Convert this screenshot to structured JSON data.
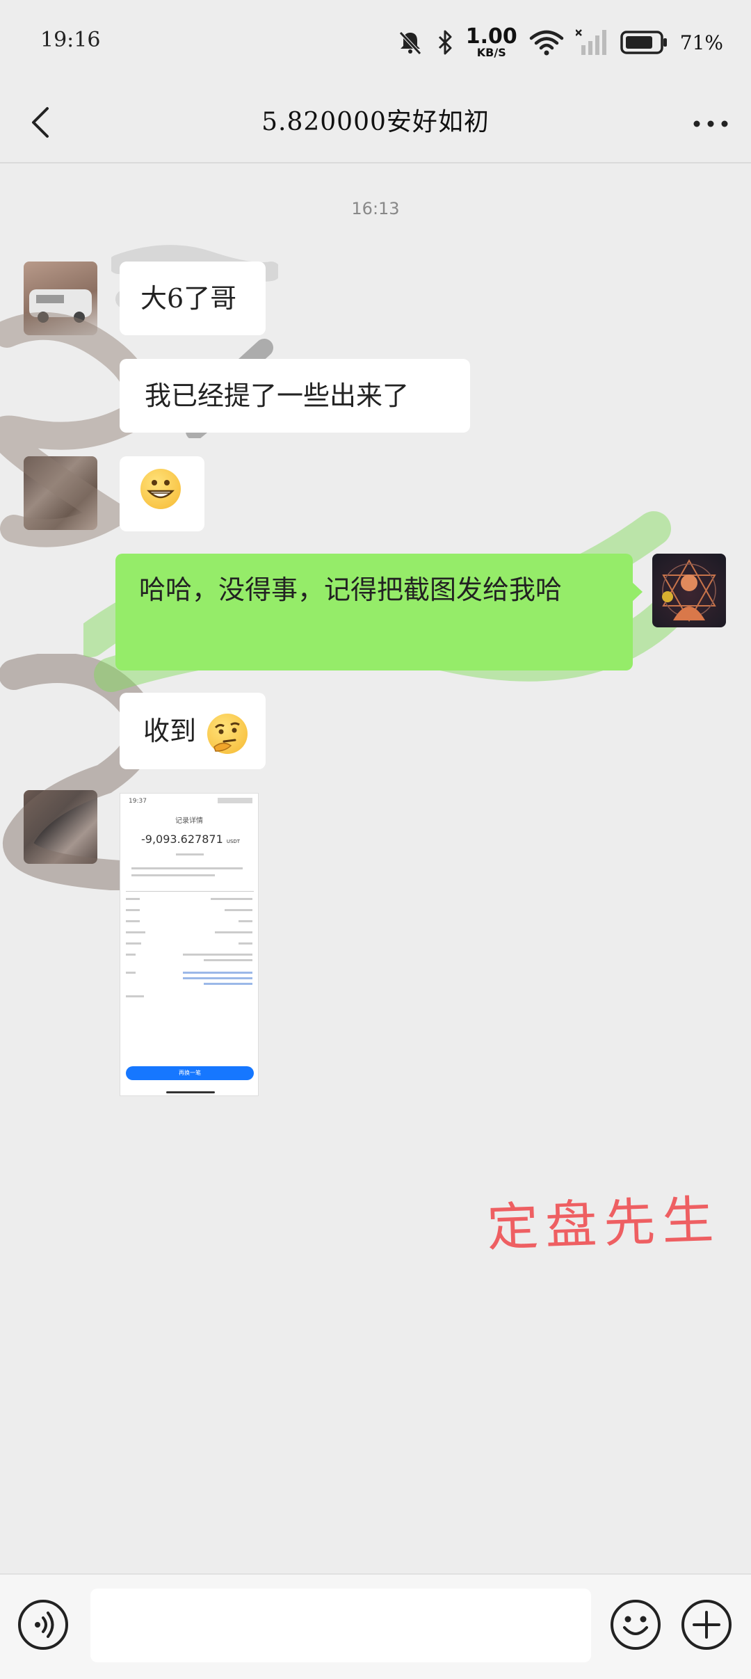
{
  "status_bar": {
    "time": "19:16",
    "net_speed_value": "1.00",
    "net_speed_unit": "KB/S",
    "battery_percent": "71%",
    "icons": [
      "mute-bell-icon",
      "bluetooth-icon",
      "wifi-icon",
      "signal-icon",
      "battery-icon"
    ]
  },
  "header": {
    "title": "5.820000安好如初"
  },
  "chat": {
    "timestamp": "16:13",
    "messages": [
      {
        "side": "left",
        "type": "text",
        "text": "大6了哥"
      },
      {
        "side": "left",
        "type": "text",
        "text": "我已经提了一些出来了"
      },
      {
        "side": "left",
        "type": "emoji",
        "emoji": "grinning-face"
      },
      {
        "side": "right",
        "type": "text",
        "text": "哈哈，没得事，记得把截图发给我哈"
      },
      {
        "side": "left",
        "type": "text",
        "text": "收到",
        "emoji": "thinking-face"
      },
      {
        "side": "left",
        "type": "image",
        "caption": "screenshot"
      }
    ],
    "screenshot": {
      "time": "19:37",
      "title": "记录详情",
      "amount": "-9,093.627871",
      "unit": "USDT",
      "button_label": "再换一笔"
    }
  },
  "watermark": "定盘先生",
  "input_bar": {
    "placeholder": "",
    "icons": [
      "voice-icon",
      "emoji-icon",
      "plus-icon"
    ]
  },
  "colors": {
    "background": "#ededed",
    "sent_bubble": "#95ec69",
    "received_bubble": "#ffffff",
    "watermark": "#ee5f62"
  }
}
